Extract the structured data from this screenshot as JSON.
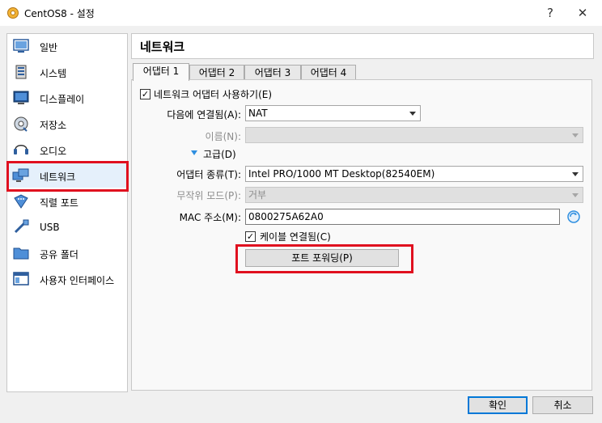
{
  "window": {
    "title": "CentOS8 - 설정",
    "help": "?",
    "close": "✕"
  },
  "sidebar": {
    "items": [
      {
        "label": "일반",
        "icon": "general-icon"
      },
      {
        "label": "시스템",
        "icon": "system-icon"
      },
      {
        "label": "디스플레이",
        "icon": "display-icon"
      },
      {
        "label": "저장소",
        "icon": "storage-icon"
      },
      {
        "label": "오디오",
        "icon": "audio-icon"
      },
      {
        "label": "네트워크",
        "icon": "network-icon"
      },
      {
        "label": "직렬 포트",
        "icon": "serial-port-icon"
      },
      {
        "label": "USB",
        "icon": "usb-icon"
      },
      {
        "label": "공유 폴더",
        "icon": "shared-folder-icon"
      },
      {
        "label": "사용자 인터페이스",
        "icon": "user-interface-icon"
      }
    ],
    "selected": "네트워크"
  },
  "header": {
    "title": "네트워크"
  },
  "tabs": [
    {
      "label": "어댑터 1"
    },
    {
      "label": "어댑터 2"
    },
    {
      "label": "어댑터 3"
    },
    {
      "label": "어댑터 4"
    }
  ],
  "form": {
    "enable_label": "네트워크 어댑터 사용하기(E)",
    "attached_label": "다음에 연결됨(A):",
    "attached_value": "NAT",
    "name_label": "이름(N):",
    "name_value": "",
    "advanced_label": "고급(D)",
    "adapter_type_label": "어댑터 종류(T):",
    "adapter_type_value": "Intel PRO/1000 MT Desktop(82540EM)",
    "promiscuous_label": "무작위 모드(P):",
    "promiscuous_value": "거부",
    "mac_label": "MAC 주소(M):",
    "mac_value": "0800275A62A0",
    "cable_label": "케이블 연결됨(C)",
    "port_forwarding_label": "포트 포워딩(P)"
  },
  "footer": {
    "ok": "확인",
    "cancel": "취소"
  },
  "colors": {
    "highlight": "#e0101f",
    "selection": "#e5f0fb",
    "accent": "#0078d7"
  }
}
